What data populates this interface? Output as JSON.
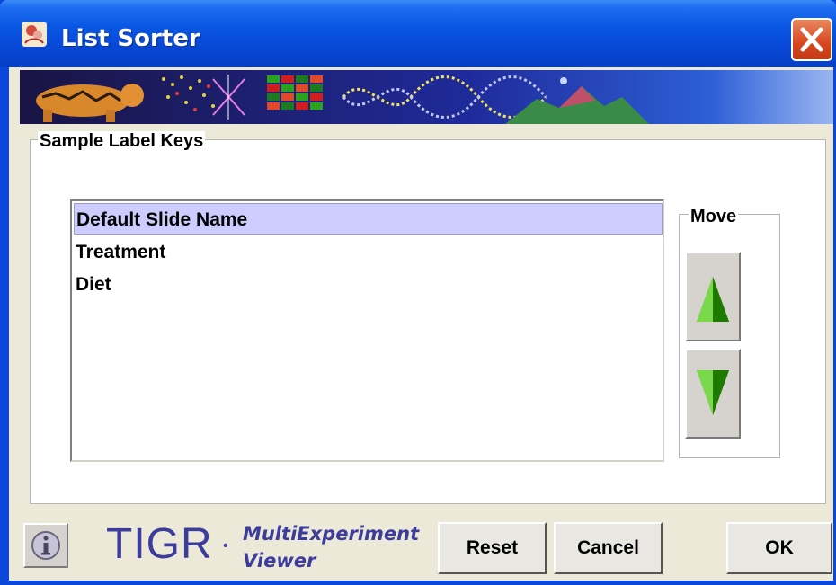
{
  "window": {
    "title": "List Sorter",
    "close_icon": "close-icon"
  },
  "banner": {
    "icon": "tigr-banner-image"
  },
  "sample_label_keys": {
    "title": "Sample Label Keys",
    "items": [
      {
        "label": "Default Slide Name",
        "selected": true
      },
      {
        "label": "Treatment",
        "selected": false
      },
      {
        "label": "Diet",
        "selected": false
      }
    ]
  },
  "move": {
    "title": "Move",
    "up_icon": "arrow-up-icon",
    "down_icon": "arrow-down-icon",
    "arrow_color": "#2d9a00"
  },
  "footer": {
    "info_icon": "info-icon",
    "logo_text": "TIGR",
    "logo_dot": "•",
    "product_line1": "MultiExperiment",
    "product_line2": "Viewer",
    "reset_label": "Reset",
    "cancel_label": "Cancel",
    "ok_label": "OK"
  }
}
